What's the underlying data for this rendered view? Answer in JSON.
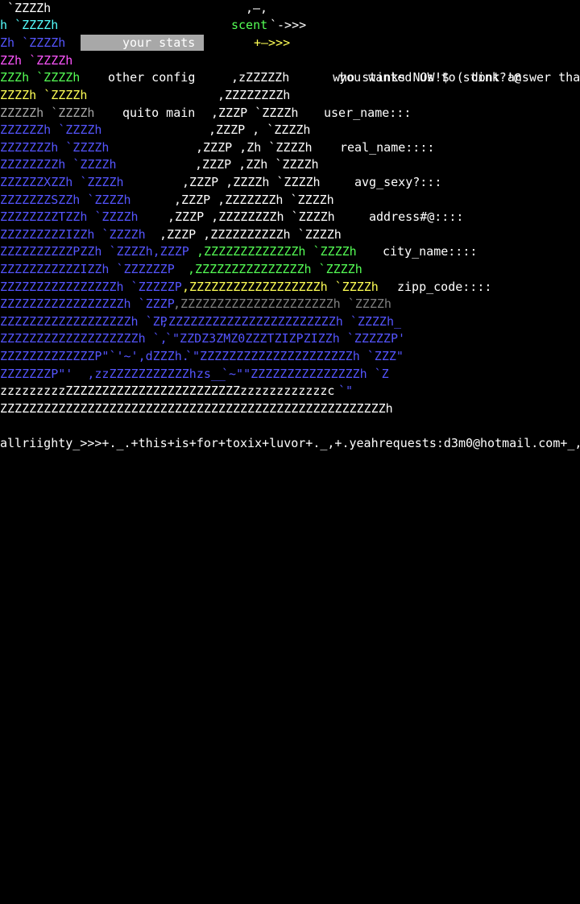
{
  "menu": {
    "your_stats": "your stats",
    "other_config": "other config",
    "quito_main": "quito main"
  },
  "fields": {
    "user_name": "user_name:::",
    "real_name": "real_name::::",
    "avg_sexy": "avg_sexy?:::",
    "address": "address#@::::",
    "city_name": "city_name::::",
    "zipp_code": "zipp_code::::"
  },
  "messages": {
    "line1_prefix": "scent",
    "line1_arrow": "`->>>",
    "line1_text": "you wanted us to stink?!@",
    "line2_arrow": "+—>>>",
    "line2_text": "who stinks NOW!$ ( dont answer that )"
  },
  "footer": "allriighty_>>>+._.+this+is+for+toxix+luvor+._,+.yeahrequests:d3m0@hotmail.com+_,",
  "art": {
    "l0": " `ZZZZh",
    "l1": "h `ZZZZh",
    "l2": "Zh `ZZZZh",
    "l3": "ZZh `ZZZZh",
    "l4": "ZZZh `ZZZZh",
    "l5": "ZZZZh `ZZZZh",
    "l6": "ZZZZZh `ZZZZh",
    "l7": "ZZZZZZh `ZZZZh",
    "l8": "ZZZZZZZh `ZZZZh",
    "l9": "ZZZZZZZZh `ZZZZh",
    "l10": "ZZZZZZXZZh `ZZZZh",
    "l11": "ZZZZZZZSZZh `ZZZZh",
    "l12": "ZZZZZZZZTZZh `ZZZZh",
    "l13": "ZZZZZZZZZIZZh `ZZZZh",
    "l14": "ZZZZZZZZZZPZZh `ZZZZh,ZZZP",
    "l15": "ZZZZZZZZZZZIZZh `ZZZZZZP",
    "l16": "ZZZZZZZZZZZZZZZZh `ZZZZZP",
    "l17": "ZZZZZZZZZZZZZZZZZh `ZZZP",
    "l18": "ZZZZZZZZZZZZZZZZZZh `ZP",
    "l19": "ZZZZZZZZZZZZZZZZZZZh `,",
    "l20": "ZZZZZZZZZZZZZP\"`'~',dZZZh.",
    "l21": "ZZZZZZZP\"'  ,zzZZZZZZZZZZZhzs__",
    "l22": "zzzzzzzzzZZZZZZZZZZZZZZZZZZZZZZZZzzzzzzzzzzzzc",
    "l23": "ZZZZZZZZZZZZZZZZZZZZZZZZZZZZZZZZZZZZZZZZZZZZZZZZZZZZZh",
    "r1": ",—,",
    "r4": ",zZZZZZh",
    "r5": ",ZZZZZZZZh",
    "r6": ",ZZZP `ZZZZh",
    "r7": ",ZZZP , `ZZZZh",
    "r8": ",ZZZP ,Zh `ZZZZh",
    "r9": ",ZZZP ,ZZh `ZZZZh",
    "r10": ",ZZZP ,ZZZZh `ZZZZh",
    "r11": ",ZZZP ,ZZZZZZZh `ZZZZh",
    "r12": ",ZZZP ,ZZZZZZZZh `ZZZZh",
    "r13": ",ZZZP ,ZZZZZZZZZZh `ZZZZh",
    "r14": ",ZZZZZZZZZZZZZh `ZZZZh",
    "r15": ",ZZZZZZZZZZZZZZZh `ZZZZh",
    "r16": ",ZZZZZZZZZZZZZZZZZZh `ZZZZh",
    "r17": ",ZZZZZZZZZZZZZZZZZZZZZh `ZZZZh",
    "r18": ",ZZZZZZZZZZZZZZZZZZZZZZZh `ZZZZh_",
    "r19": "`\"ZZDZ3ZMZ0ZZZTZIZPZIZZh `ZZZZZP'",
    "r20": "`\"ZZZZZZZZZZZZZZZZZZZZZh `ZZZ\"",
    "r21": "`~\"\"ZZZZZZZZZZZZZZZh `Z",
    "r22": "`\""
  },
  "palette": {
    "background": "#000000",
    "blue": "#5555ff",
    "cyan": "#55ffff",
    "green": "#55ff55",
    "yellow": "#ffff55",
    "magenta": "#ff55ff",
    "selection_bg": "#a8a8a8"
  }
}
